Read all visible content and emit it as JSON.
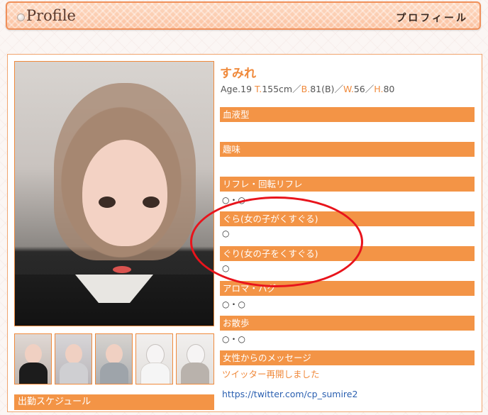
{
  "header": {
    "title": "Profile",
    "title_jp": "プロフィール"
  },
  "profile": {
    "name": "すみれ",
    "age_label": "Age.19",
    "t_key": "T.",
    "t_val": "155cm",
    "b_key": "B.",
    "b_val": "81(B)",
    "w_key": "W.",
    "w_val": "56",
    "h_key": "H.",
    "h_val": "80",
    "sep": "／"
  },
  "sections": [
    {
      "label": "血液型",
      "value": ""
    },
    {
      "label": "趣味",
      "value": ""
    },
    {
      "label": "リフレ・回転リフレ",
      "value": "○・○"
    },
    {
      "label": "ぐら(女の子がくすぐる)",
      "value": "○"
    },
    {
      "label": "ぐり(女の子をくすぐる)",
      "value": "○"
    },
    {
      "label": "アロマ・ハグ",
      "value": "○・○"
    },
    {
      "label": "お散歩",
      "value": "○・○"
    },
    {
      "label": "女性からのメッセージ",
      "value": ""
    }
  ],
  "message": "ツイッター再開しました",
  "twitter_link": "https://twitter.com/cp_sumire2",
  "schedule_label": "出勤スケジュール",
  "colors": {
    "accent": "#f39446",
    "annotation": "#e8141c",
    "link": "#2a5fb0"
  },
  "thumbnails": [
    "thumb-1",
    "thumb-2",
    "thumb-3",
    "thumb-4",
    "thumb-5"
  ]
}
